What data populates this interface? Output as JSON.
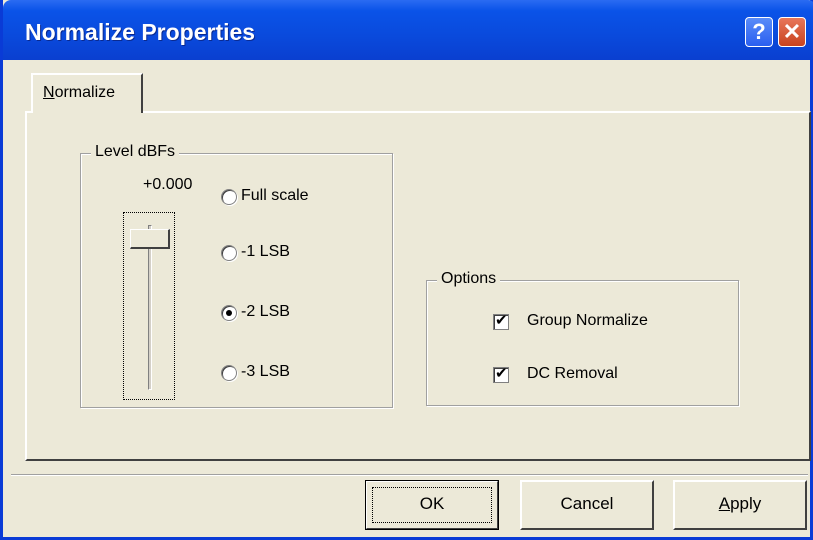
{
  "window": {
    "title": "Normalize Properties",
    "help_label": "?",
    "close_label": "✕"
  },
  "tabs": [
    {
      "label_first": "N",
      "label_rest": "ormalize"
    }
  ],
  "level": {
    "group_label": "Level dBFs",
    "value": "+0.000",
    "radios": [
      {
        "label": "Full scale",
        "checked": false
      },
      {
        "label": "-1 LSB",
        "checked": false
      },
      {
        "label": "-2 LSB",
        "checked": true
      },
      {
        "label": "-3 LSB",
        "checked": false
      }
    ]
  },
  "options": {
    "group_label": "Options",
    "checkboxes": [
      {
        "label": "Group Normalize",
        "checked": true
      },
      {
        "label": "DC Removal",
        "checked": true
      }
    ]
  },
  "buttons": {
    "ok": "OK",
    "cancel": "Cancel",
    "apply_first": "A",
    "apply_rest": "pply"
  },
  "icons": {
    "check_glyph": "✔"
  }
}
